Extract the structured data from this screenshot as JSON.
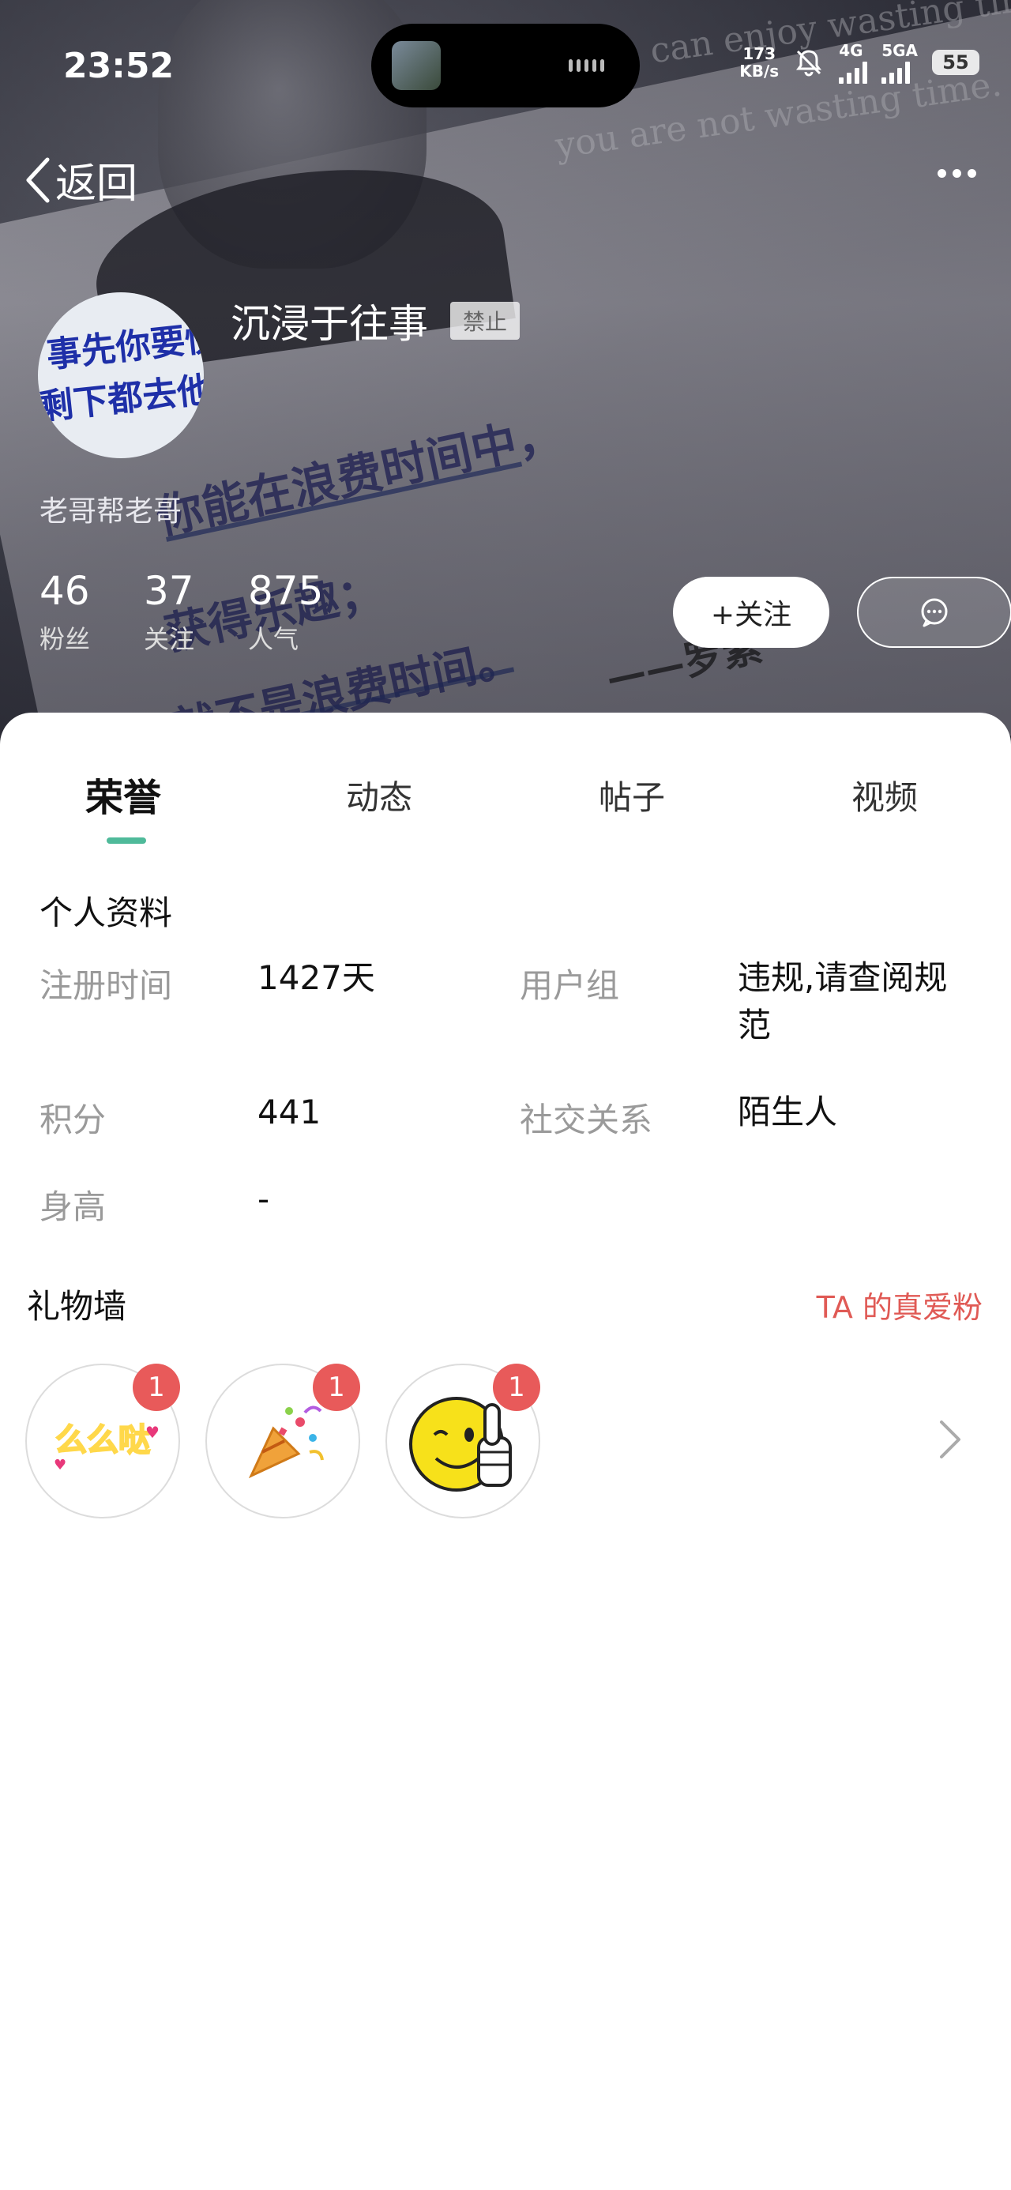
{
  "status_bar": {
    "time": "23:52",
    "net_speed_top": "173",
    "net_speed_bottom": "KB/s",
    "network_1": "4G",
    "network_2": "5GA",
    "battery": "55"
  },
  "nav": {
    "back_label": "返回"
  },
  "profile": {
    "username": "沉浸于往事",
    "ban_badge": "禁止",
    "signature": "老哥帮老哥",
    "stats": [
      {
        "value": "46",
        "label": "粉丝"
      },
      {
        "value": "37",
        "label": "关注"
      },
      {
        "value": "875",
        "label": "人气"
      }
    ],
    "follow_label": "+关注"
  },
  "tabs": [
    {
      "label": "荣誉",
      "active": true
    },
    {
      "label": "动态",
      "active": false
    },
    {
      "label": "帖子",
      "active": false
    },
    {
      "label": "视频",
      "active": false
    }
  ],
  "info": {
    "title": "个人资料",
    "reg_key": "注册时间",
    "reg_val": "1427天",
    "group_key": "用户组",
    "group_val_1": "违规,请查阅规",
    "group_val_2": "范",
    "points_key": "积分",
    "points_val": "441",
    "social_key": "社交关系",
    "social_val": "陌生人",
    "height_key": "身高",
    "height_val": "-"
  },
  "gifts": {
    "title": "礼物墙",
    "fans_link": "TA 的真爱粉",
    "items": [
      {
        "name": "么么哒",
        "count": "1"
      },
      {
        "name": "礼花",
        "count": "1"
      },
      {
        "name": "点赞",
        "count": "1"
      }
    ]
  },
  "colors": {
    "accent_green": "#4fba9a",
    "link_red": "#e05a55",
    "badge_red": "#e85a5a"
  }
}
